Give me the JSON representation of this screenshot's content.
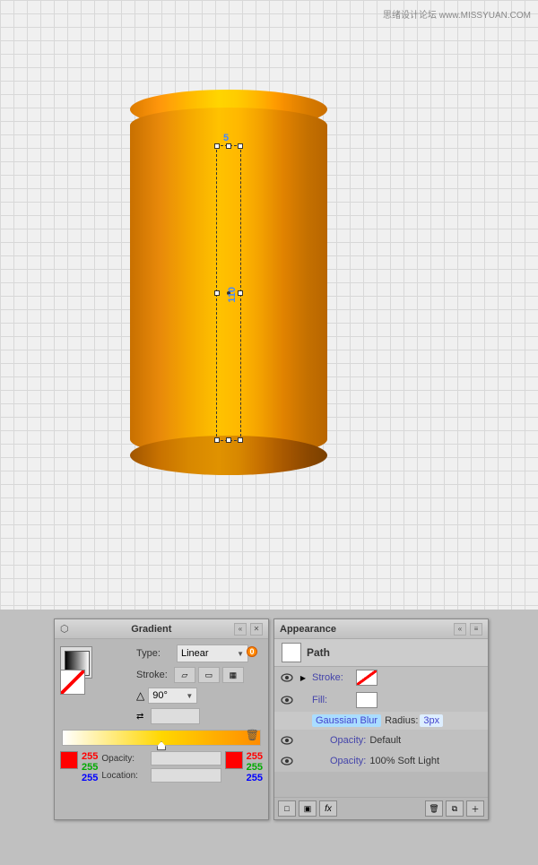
{
  "watermark": {
    "text": "思绪设计论坛 www.MISSYUAN.COM"
  },
  "canvas": {
    "bg_color": "#f0f0f0"
  },
  "cylinder": {
    "dim_width": "5",
    "dim_height": "110"
  },
  "gradient_panel": {
    "title": "Gradient",
    "type_label": "Type:",
    "type_value": "Linear",
    "stroke_label": "Stroke:",
    "angle_value": "90°",
    "opacity_label": "Opacity:",
    "location_label": "Location:",
    "rgb_left": {
      "r": "255",
      "g": "255",
      "b": "255"
    },
    "rgb_right": {
      "r": "255",
      "g": "255",
      "b": "255"
    }
  },
  "appearance_panel": {
    "title": "Appearance",
    "path_label": "Path",
    "stroke_label": "Stroke:",
    "fill_label": "Fill:",
    "gaussian_blur_label": "Gaussian Blur",
    "radius_label": "Radius:",
    "radius_value": "3px",
    "opacity1_label": "Opacity:",
    "opacity1_value": "Default",
    "opacity2_label": "Opacity:",
    "opacity2_value": "100% Soft Light"
  }
}
